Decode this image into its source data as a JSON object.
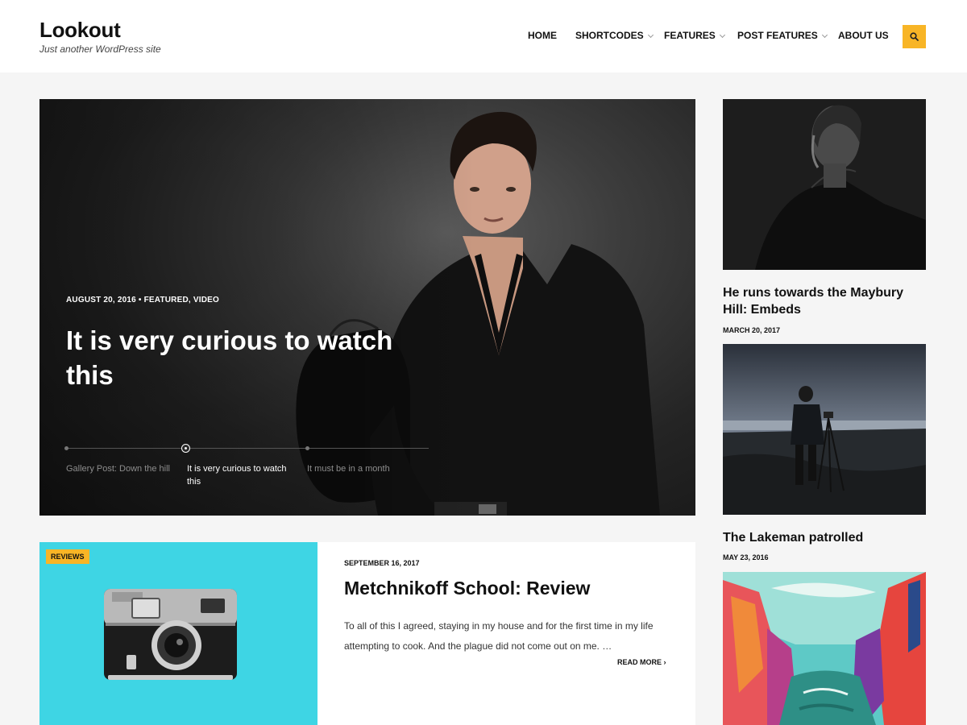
{
  "site": {
    "title": "Lookout",
    "tagline": "Just another WordPress site"
  },
  "nav": {
    "items": [
      {
        "label": "HOME",
        "has_dropdown": false
      },
      {
        "label": "SHORTCODES",
        "has_dropdown": true
      },
      {
        "label": "FEATURES",
        "has_dropdown": true
      },
      {
        "label": "POST FEATURES",
        "has_dropdown": true
      },
      {
        "label": "ABOUT US",
        "has_dropdown": false
      }
    ],
    "search_icon": "search-icon"
  },
  "hero": {
    "meta": "AUGUST 20, 2016 • FEATURED, VIDEO",
    "title": "It is very curious to watch this",
    "slides": [
      {
        "label": "Gallery Post: Down the hill",
        "active": false
      },
      {
        "label": "It is very curious to watch this",
        "active": true
      },
      {
        "label": "It must be in a month",
        "active": false
      }
    ]
  },
  "review_post": {
    "badge": "REVIEWS",
    "date": "SEPTEMBER 16, 2017",
    "title": "Metchnikoff School: Review",
    "excerpt": "To all of this I agreed, staying in my house and for the first time in my life attempting to cook. And the plague did not come out on me. …",
    "read_more": "READ MORE ›"
  },
  "sidebar": {
    "posts": [
      {
        "title": "He runs towards the Maybury Hill: Embeds",
        "date": "MARCH 20, 2017"
      },
      {
        "title": "The Lakeman patrolled",
        "date": "MAY 23, 2016"
      }
    ]
  },
  "colors": {
    "accent": "#f8b526",
    "page_background": "#f5f5f5",
    "review_image_background": "#3ed5e4"
  }
}
